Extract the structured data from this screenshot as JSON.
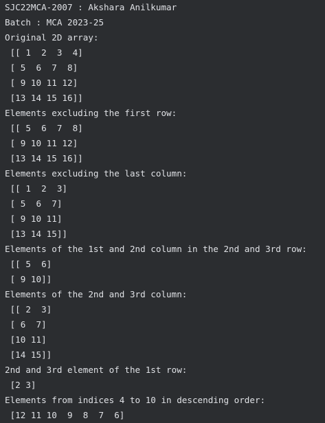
{
  "output": {
    "lines": [
      "SJC22MCA-2007 : Akshara Anilkumar",
      "Batch : MCA 2023-25",
      "Original 2D array:",
      " [[ 1  2  3  4]",
      " [ 5  6  7  8]",
      " [ 9 10 11 12]",
      " [13 14 15 16]]",
      "Elements excluding the first row:",
      " [[ 5  6  7  8]",
      " [ 9 10 11 12]",
      " [13 14 15 16]]",
      "Elements excluding the last column:",
      " [[ 1  2  3]",
      " [ 5  6  7]",
      " [ 9 10 11]",
      " [13 14 15]]",
      "Elements of the 1st and 2nd column in the 2nd and 3rd row:",
      " [[ 5  6]",
      " [ 9 10]]",
      "Elements of the 2nd and 3rd column:",
      " [[ 2  3]",
      " [ 6  7]",
      " [10 11]",
      " [14 15]]",
      "2nd and 3rd element of the 1st row:",
      " [2 3]",
      "Elements from indices 4 to 10 in descending order:",
      " [12 11 10  9  8  7  6]"
    ]
  }
}
